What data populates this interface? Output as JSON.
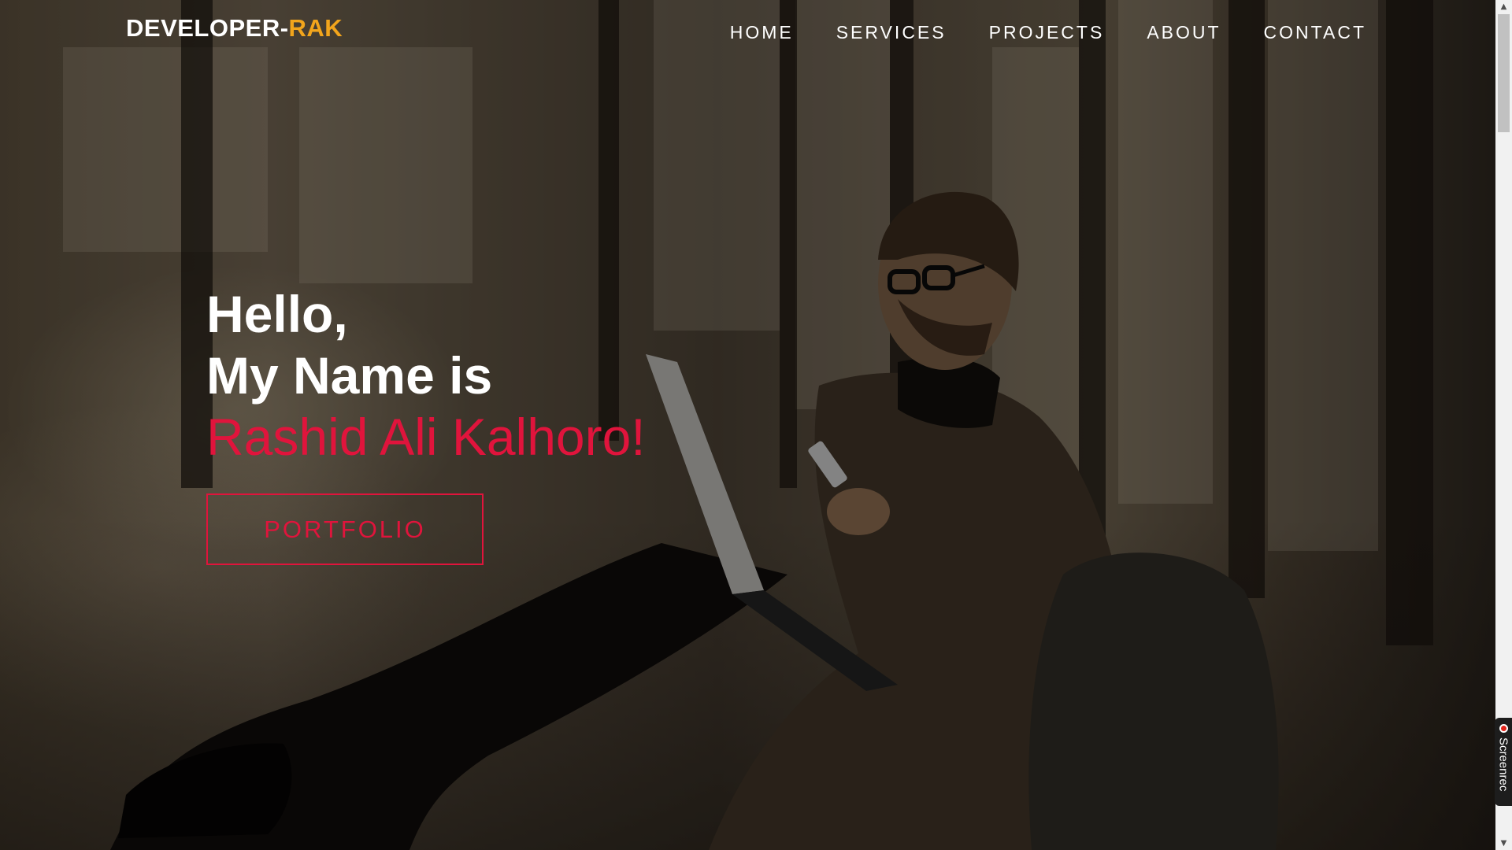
{
  "brand": {
    "name_prefix": "DEVELOPER-",
    "name_suffix": "RAK",
    "accent_color": "#f2a51c"
  },
  "nav": {
    "items": [
      {
        "label": "HOME"
      },
      {
        "label": "SERVICES"
      },
      {
        "label": "PROJECTS"
      },
      {
        "label": "ABOUT"
      },
      {
        "label": "CONTACT"
      }
    ]
  },
  "hero": {
    "greeting": "Hello,",
    "intro": "My Name is",
    "name": "Rashid Ali Kalhoro!",
    "cta_label": "PORTFOLIO",
    "accent_color": "#e0143c"
  },
  "recorder": {
    "label": "Screenrec",
    "icon": "record-icon"
  },
  "scrollbar": {
    "up_icon": "arrow-up-icon",
    "down_icon": "arrow-down-icon"
  }
}
